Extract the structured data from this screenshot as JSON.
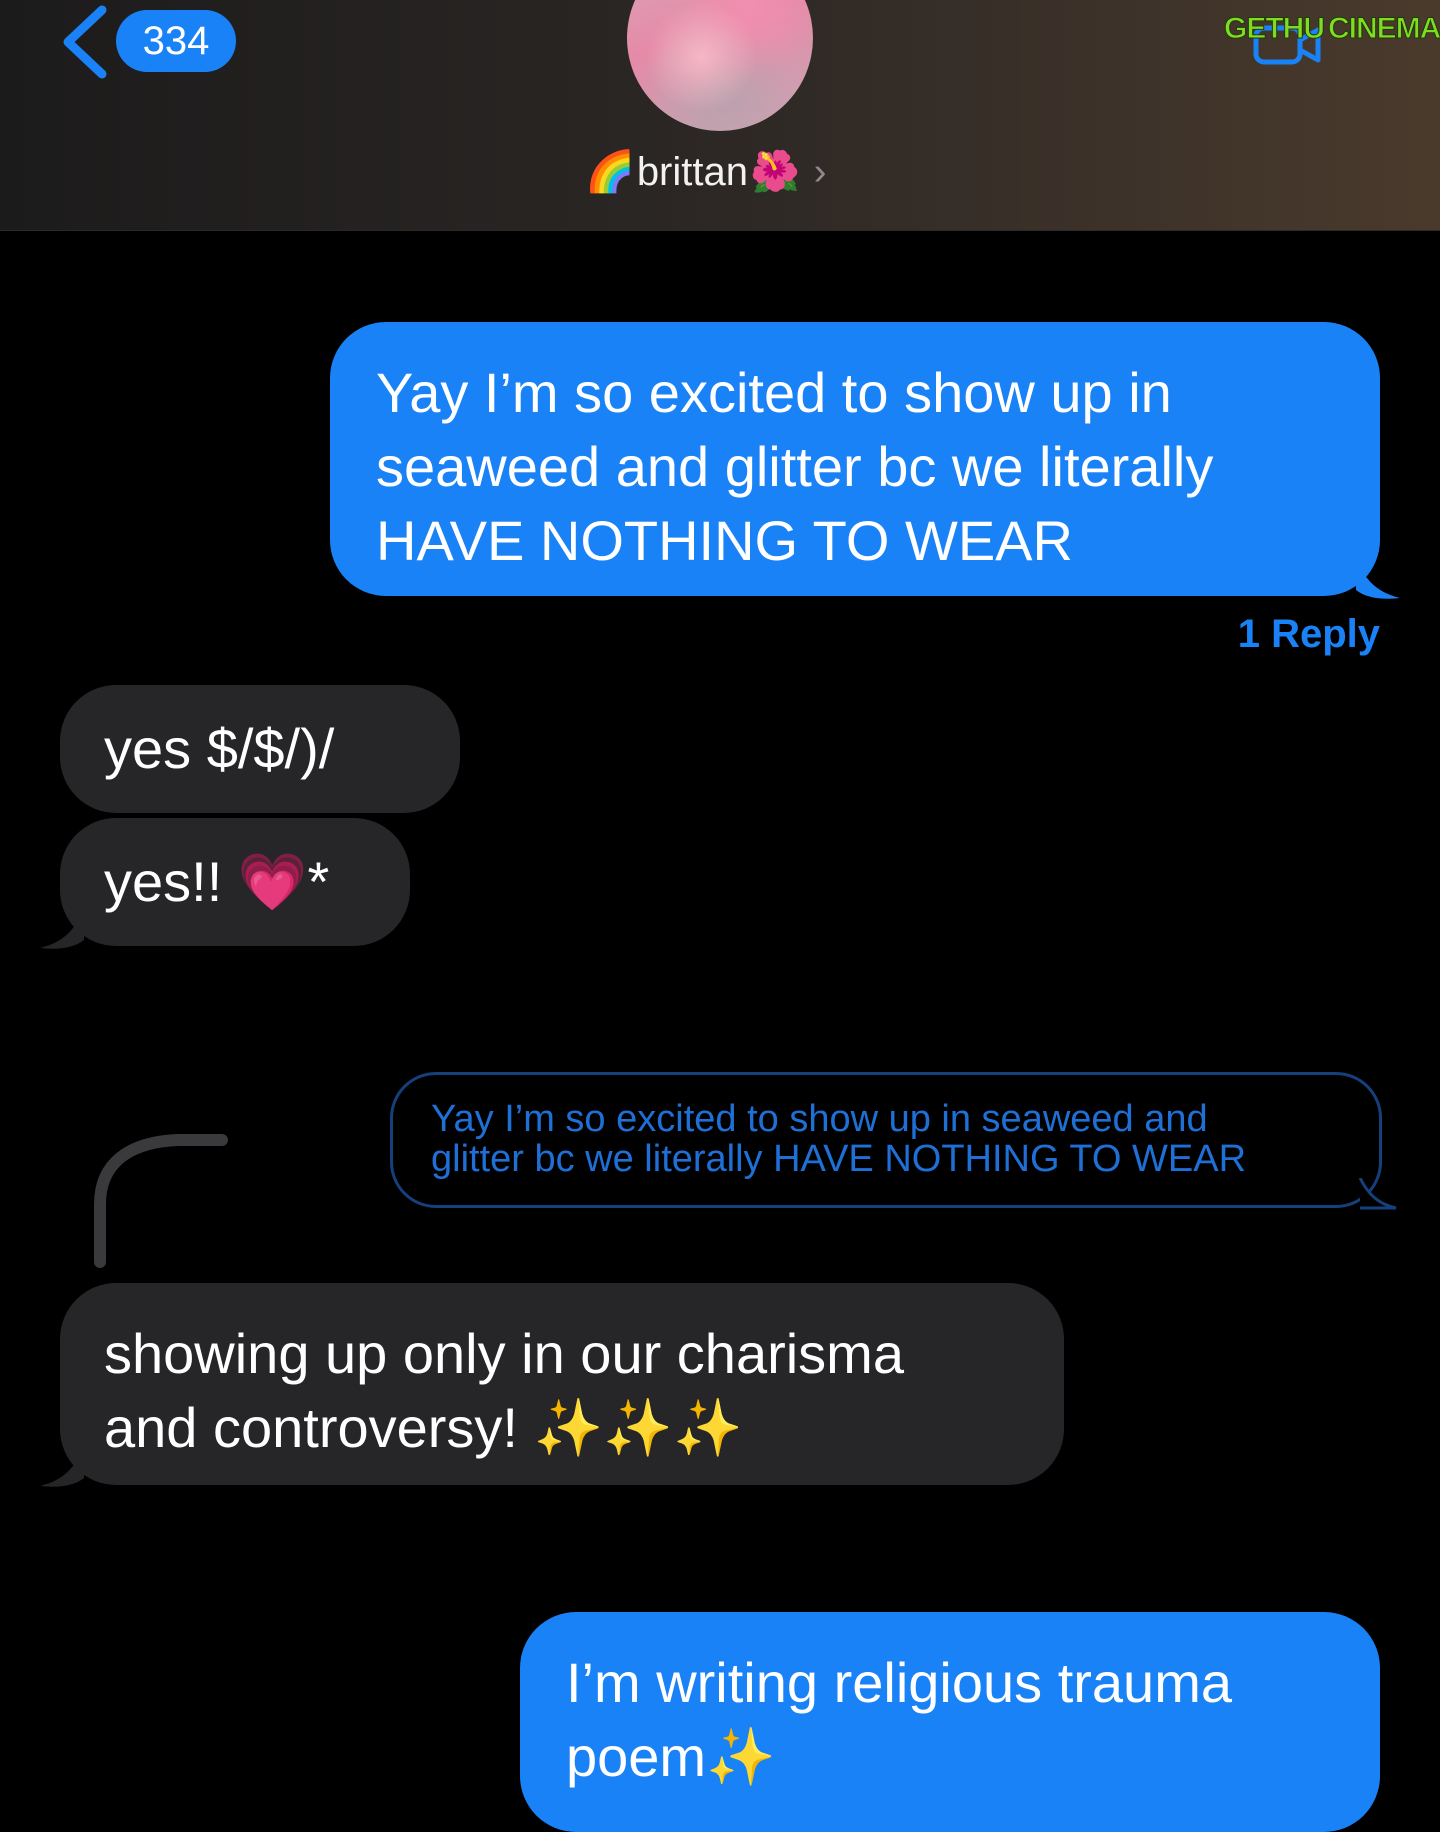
{
  "header": {
    "back_count": "334",
    "contact_prefix_emoji": "🌈",
    "contact_name": "brittan",
    "contact_suffix_emoji": "🌺",
    "contact_chevron": "›",
    "watermark_part1": "GETHU",
    "watermark_part2": "CINEMA"
  },
  "colors": {
    "sent_bubble": "#1a82f7",
    "received_bubble": "#262628",
    "background": "#000000",
    "accent": "#1a82f7"
  },
  "messages": [
    {
      "direction": "sent",
      "text": "Yay I’m so excited to show up in\nseaweed and glitter bc we literally\nHAVE NOTHING TO WEAR"
    },
    {
      "direction": "received",
      "text": "yes   $/$/)/"
    },
    {
      "direction": "received",
      "text": "yes!! 💗*"
    },
    {
      "direction": "quoted",
      "text": "Yay I’m so excited to show up in seaweed and\nglitter bc we literally HAVE NOTHING TO WEAR"
    },
    {
      "direction": "received",
      "text": "showing up only in our charisma\nand controversy! ✨✨✨"
    },
    {
      "direction": "sent",
      "text": "I’m writing religious trauma\npoem✨"
    }
  ],
  "thread": {
    "reply_count_label": "1 Reply"
  },
  "icons": {
    "back": "chevron-left-icon",
    "contact_detail": "chevron-right-icon",
    "video_call": "video-camera-icon"
  }
}
